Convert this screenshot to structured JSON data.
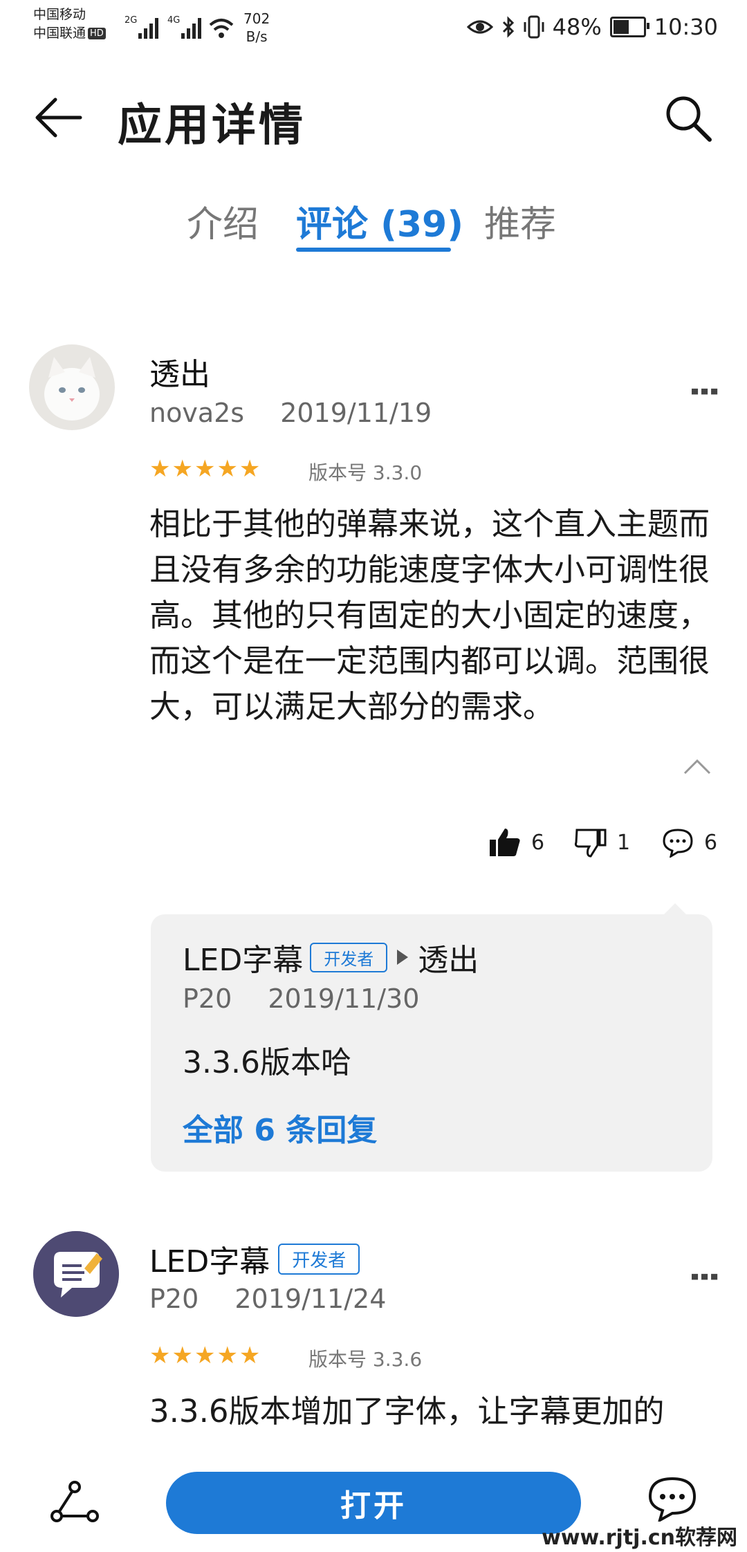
{
  "status_bar": {
    "carrier1": "中国移动",
    "carrier2": "中国联通",
    "hd": "HD",
    "net1": "2G",
    "net2": "4G",
    "speed_value": "702",
    "speed_unit": "B/s",
    "battery": "48%",
    "time": "10:30"
  },
  "header": {
    "title": "应用详情"
  },
  "tabs": [
    {
      "label": "介绍"
    },
    {
      "label": "评论 (39)"
    },
    {
      "label": "推荐"
    }
  ],
  "reviews": [
    {
      "author": "透出",
      "device": "nova2s",
      "date": "2019/11/19",
      "rating": 5,
      "stars": "★★★★★",
      "version": "版本号 3.3.0",
      "text": "相比于其他的弹幕来说，这个直入主题而且没有多余的功能速度字体大小可调性很高。其他的只有固定的大小固定的速度，而这个是在一定范围内都可以调。范围很大，可以满足大部分的需求。",
      "likes": "6",
      "dislikes": "1",
      "comments": "6",
      "reply": {
        "author": "LED字幕",
        "badge": "开发者",
        "to": "透出",
        "device": "P20",
        "date": "2019/11/30",
        "text": "3.3.6版本哈",
        "all_replies": "全部 6 条回复"
      }
    },
    {
      "author": "LED字幕",
      "badge": "开发者",
      "device": "P20",
      "date": "2019/11/24",
      "rating": 5,
      "stars": "★★★★★",
      "version": "版本号 3.3.6",
      "text": "3.3.6版本增加了字体，让字幕更加的"
    }
  ],
  "bottom_bar": {
    "open_label": "打开"
  },
  "watermark": "www.rjtj.cn软荐网",
  "colors": {
    "accent": "#1e7ad6",
    "star": "#f5a623"
  }
}
